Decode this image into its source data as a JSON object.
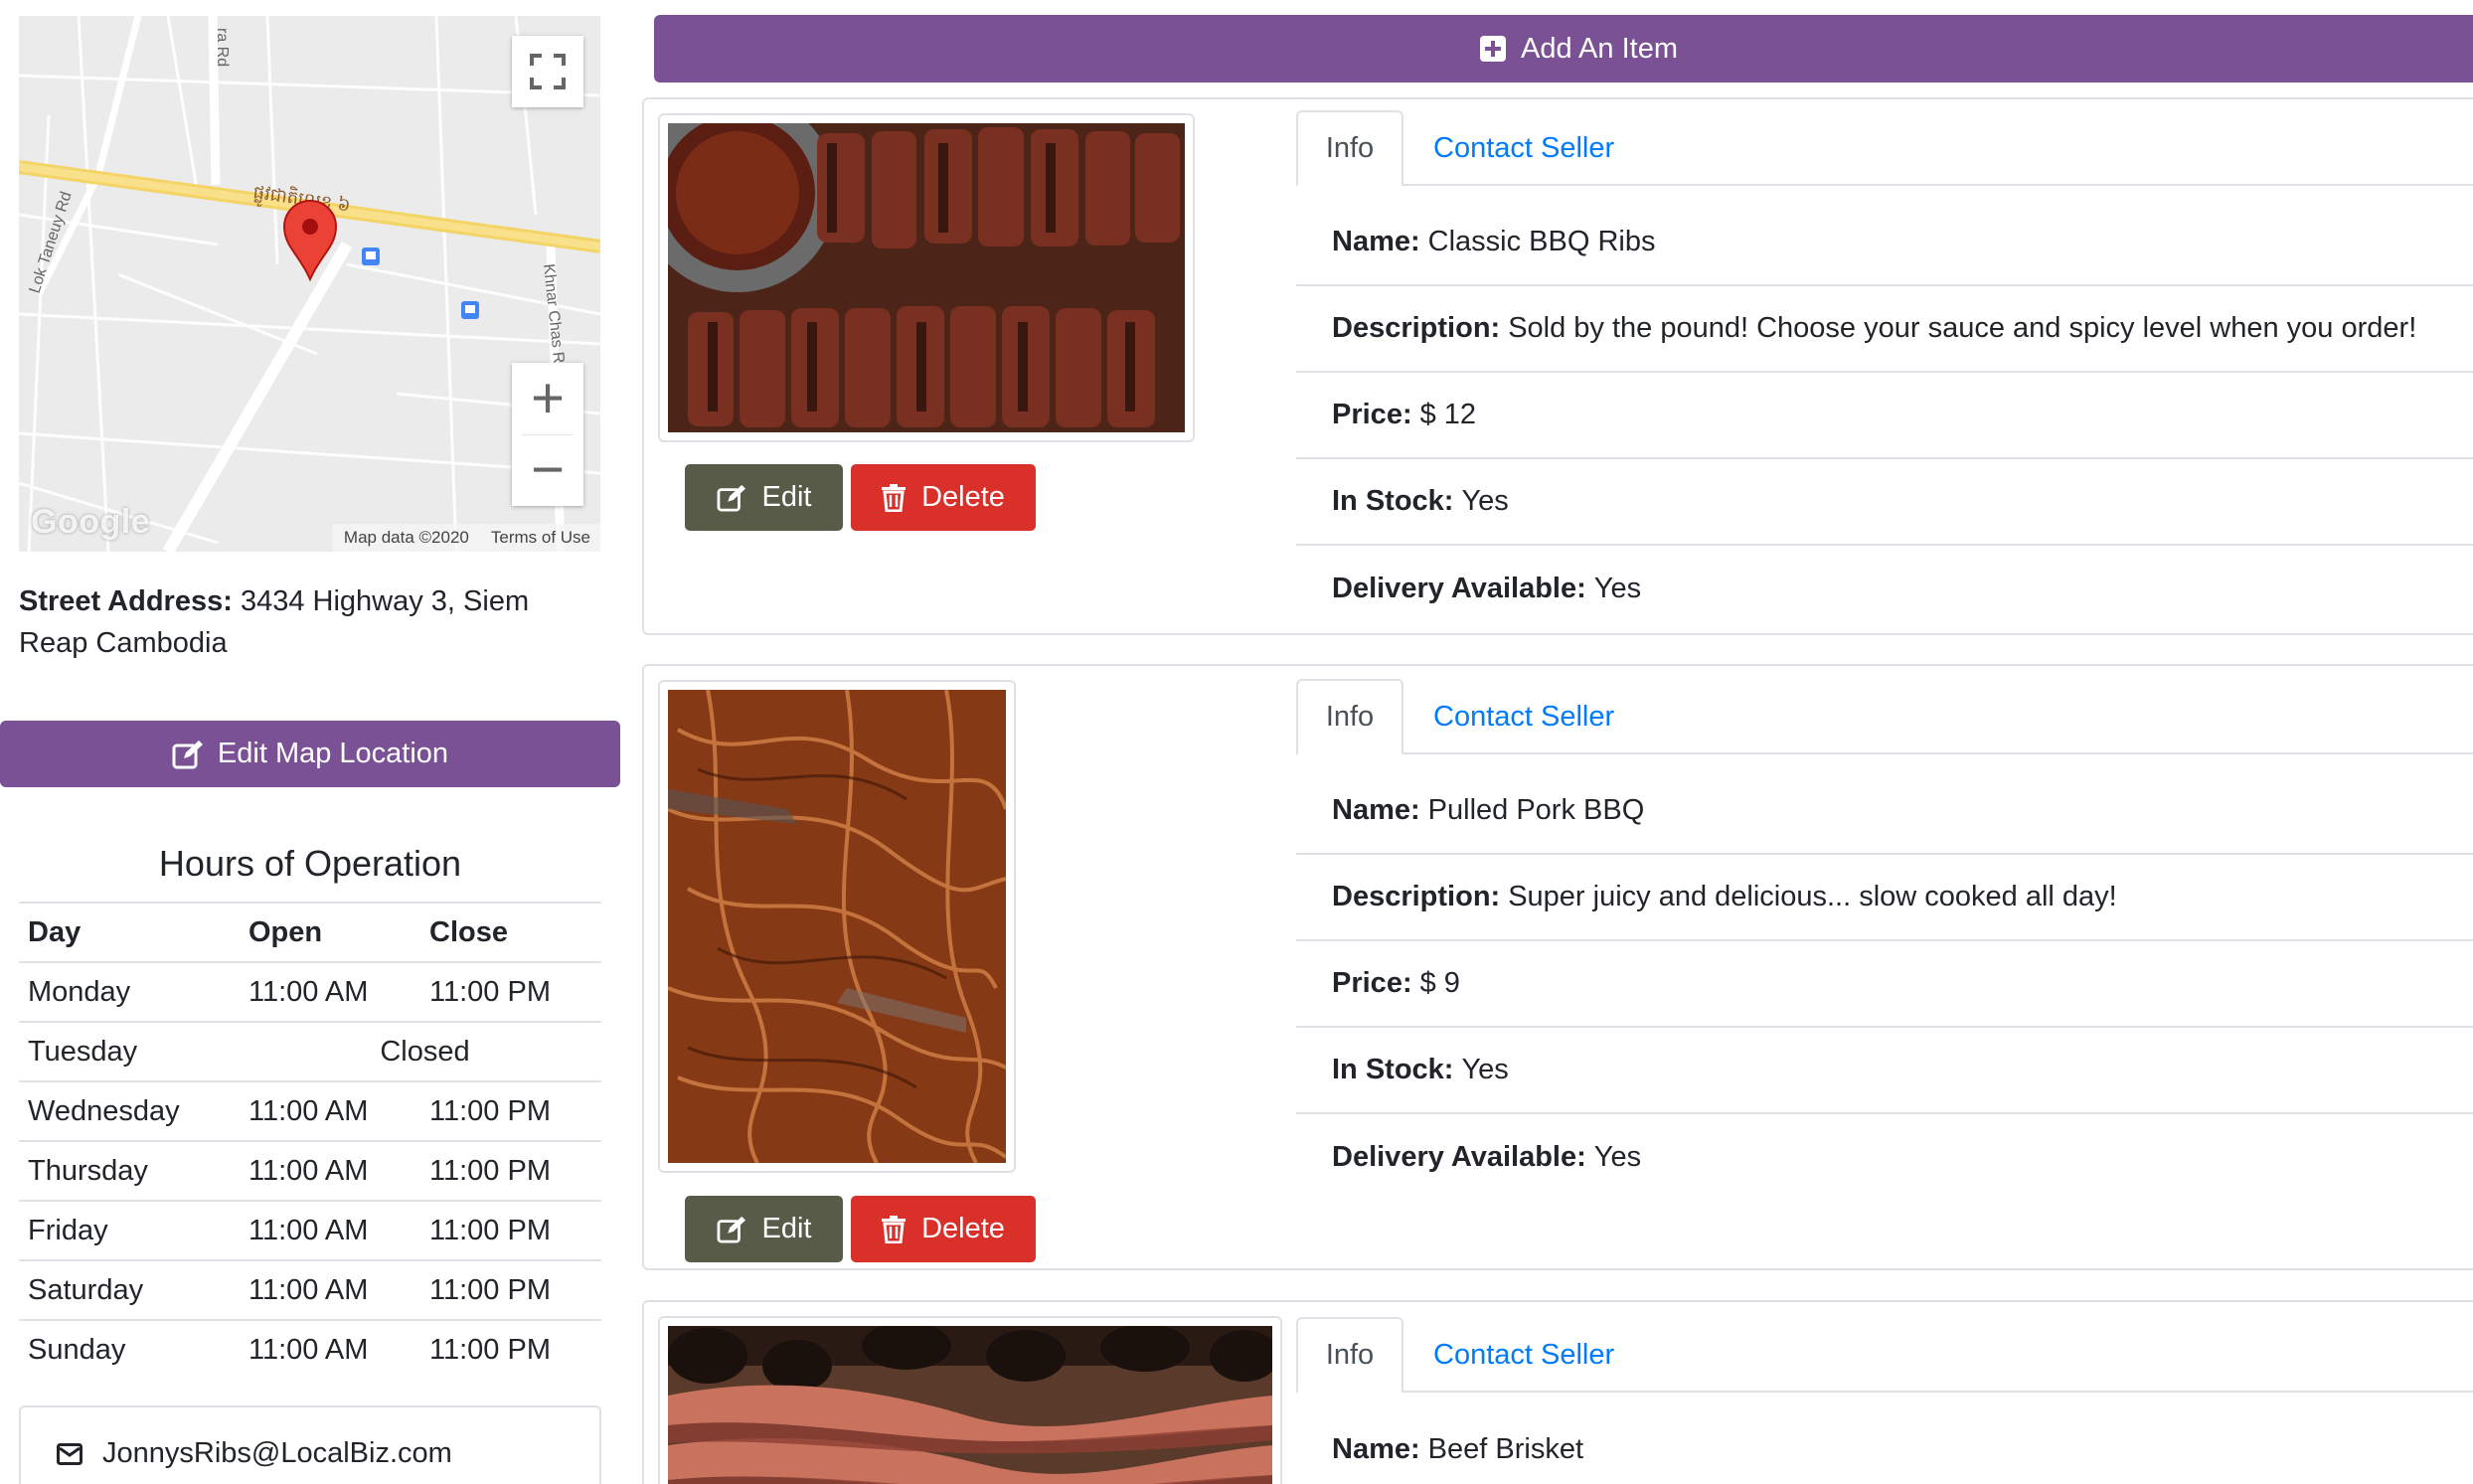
{
  "map": {
    "road_labels": [
      "ra Rd",
      "Lok Taneuy Rd",
      "Khnar Chas R",
      "ផ្លូវជាតិលេខ ៦"
    ],
    "google": "Google",
    "map_data": "Map data ©2020",
    "terms": "Terms of Use",
    "controls": {
      "fullscreen": "fullscreen-icon",
      "zoom_in": "+",
      "zoom_out": "−"
    }
  },
  "address": {
    "label": "Street Address:",
    "value": "3434 Highway 3, Siem Reap Cambodia"
  },
  "edit_map_button": "Edit Map Location",
  "hours": {
    "title": "Hours of Operation",
    "headers": [
      "Day",
      "Open",
      "Close"
    ],
    "rows": [
      {
        "day": "Monday",
        "open": "11:00 AM",
        "close": "11:00 PM"
      },
      {
        "day": "Tuesday",
        "closed": "Closed"
      },
      {
        "day": "Wednesday",
        "open": "11:00 AM",
        "close": "11:00 PM"
      },
      {
        "day": "Thursday",
        "open": "11:00 AM",
        "close": "11:00 PM"
      },
      {
        "day": "Friday",
        "open": "11:00 AM",
        "close": "11:00 PM"
      },
      {
        "day": "Saturday",
        "open": "11:00 AM",
        "close": "11:00 PM"
      },
      {
        "day": "Sunday",
        "open": "11:00 AM",
        "close": "11:00 PM"
      }
    ]
  },
  "email": "JonnysRibs@LocalBiz.com",
  "add_item_button": "Add An Item",
  "labels": {
    "tab_info": "Info",
    "tab_contact": "Contact Seller",
    "edit": "Edit",
    "delete": "Delete",
    "name": "Name:",
    "description": "Description:",
    "price": "Price:",
    "in_stock": "In Stock:",
    "delivery": "Delivery Available:"
  },
  "items": [
    {
      "name": "Classic BBQ Ribs",
      "description": "Sold by the pound! Choose your sauce and spicy level when you order!",
      "price": "$ 12",
      "in_stock": "Yes",
      "delivery": "Yes"
    },
    {
      "name": "Pulled Pork BBQ",
      "description": "Super juicy and delicious... slow cooked all day!",
      "price": "$ 9",
      "in_stock": "Yes",
      "delivery": "Yes"
    },
    {
      "name": "Beef Brisket"
    }
  ],
  "colors": {
    "purple": "#7a5195",
    "edit_button": "#575b48",
    "delete_button": "#d9302a",
    "link": "#007bff",
    "map_marker": "#ea4335"
  }
}
